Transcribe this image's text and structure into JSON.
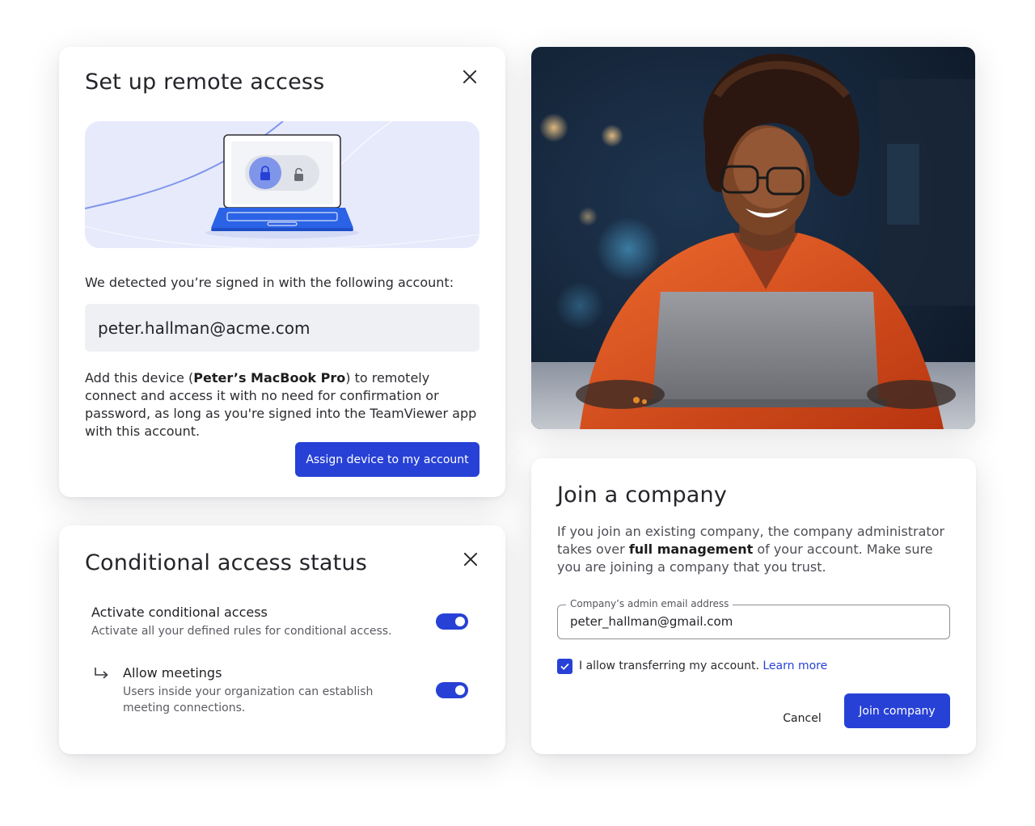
{
  "remote_access": {
    "title": "Set up remote access",
    "account_label": "We detected you’re signed in with the following account:",
    "account_email": "peter.hallman@acme.com",
    "desc_part1": "Add this device (",
    "device_name": "Peter’s MacBook Pro",
    "desc_part2": ") to remotely connect and access it with no need for confirmation or password, as long as you're signed into the TeamViewer app with this account.",
    "assign_button": "Assign device to my account"
  },
  "conditional_access": {
    "title": "Conditional access status",
    "rows": [
      {
        "title": "Activate conditional access",
        "subtitle": "Activate all your defined rules for conditional access.",
        "enabled": true
      },
      {
        "title": "Allow meetings",
        "subtitle": "Users inside your organization can establish meeting connections.",
        "enabled": true
      }
    ]
  },
  "join_company": {
    "title": "Join a company",
    "desc_part1": "If you join an existing company, the company administrator takes over ",
    "desc_bold": "full management",
    "desc_part2": " of your account. Make sure you are joining a company that you trust.",
    "field_label": "Company’s admin email address",
    "field_value": "peter_hallman@gmail.com",
    "checkbox_checked": true,
    "checkbox_label": "I allow transferring my account.",
    "learn_more": "Learn more",
    "cancel_button": "Cancel",
    "join_button": "Join company"
  },
  "colors": {
    "accent": "#2741d6",
    "illustration_bg": "#e6eafb",
    "shirt": "#d9471c"
  },
  "icons": [
    "close-icon",
    "lock-icon",
    "unlock-icon",
    "check-icon",
    "subdirectory-arrow-icon"
  ]
}
